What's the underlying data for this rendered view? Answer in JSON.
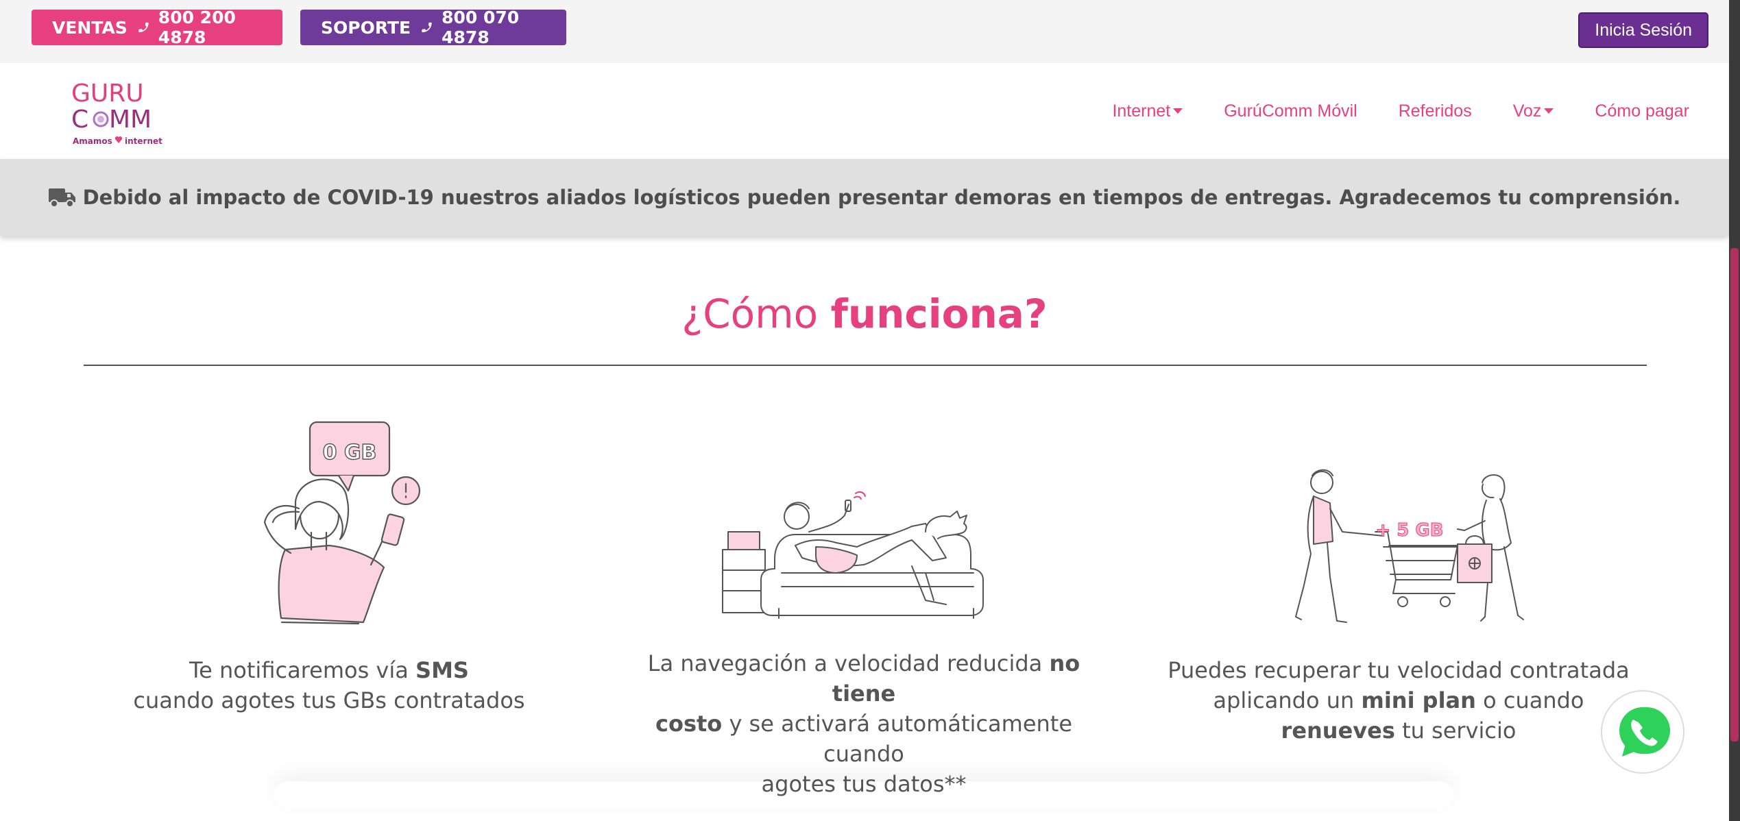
{
  "topbar": {
    "ventas_label": "VENTAS",
    "ventas_phone": "800 200 4878",
    "soporte_label": "SOPORTE",
    "soporte_phone": "800 070 4878",
    "login_label": "Inicia Sesión"
  },
  "logo": {
    "line1": "GURU",
    "line2": "COMM",
    "tagline": "Amamos ♥ internet"
  },
  "nav": {
    "items": [
      {
        "label": "Internet",
        "dropdown": true
      },
      {
        "label": "GurúComm Móvil",
        "dropdown": false
      },
      {
        "label": "Referidos",
        "dropdown": false
      },
      {
        "label": "Voz",
        "dropdown": true
      },
      {
        "label": "Cómo pagar",
        "dropdown": false
      }
    ]
  },
  "notice": {
    "icon": "truck-icon",
    "text": "Debido al impacto de COVID-19 nuestros aliados logísticos pueden presentar demoras en tiempos de entregas. Agradecemos tu comprensión."
  },
  "section": {
    "title_light": "¿Cómo ",
    "title_bold": "funciona?"
  },
  "columns": [
    {
      "bubble": "0 GB",
      "line1_a": "Te notificaremos vía ",
      "line1_b": "SMS",
      "line2": "cuando agotes tus GBs contratados"
    },
    {
      "line1_a": "La navegación a velocidad reducida ",
      "line1_b": "no tiene",
      "line2_a": "costo",
      "line2_b": " y se activará automáticamente cuando",
      "line3": "agotes tus datos**"
    },
    {
      "badge": "+ 5 GB",
      "line1": "Puedes recuperar tu velocidad contratada",
      "line2_a": "aplicando un ",
      "line2_b": "mini plan",
      "line2_c": " o cuando",
      "line3_a": "renueves",
      "line3_b": " tu servicio"
    }
  ],
  "colors": {
    "pink": "#e6407e",
    "purple": "#6f3b9b",
    "notice_bg": "#e0e0e0"
  }
}
